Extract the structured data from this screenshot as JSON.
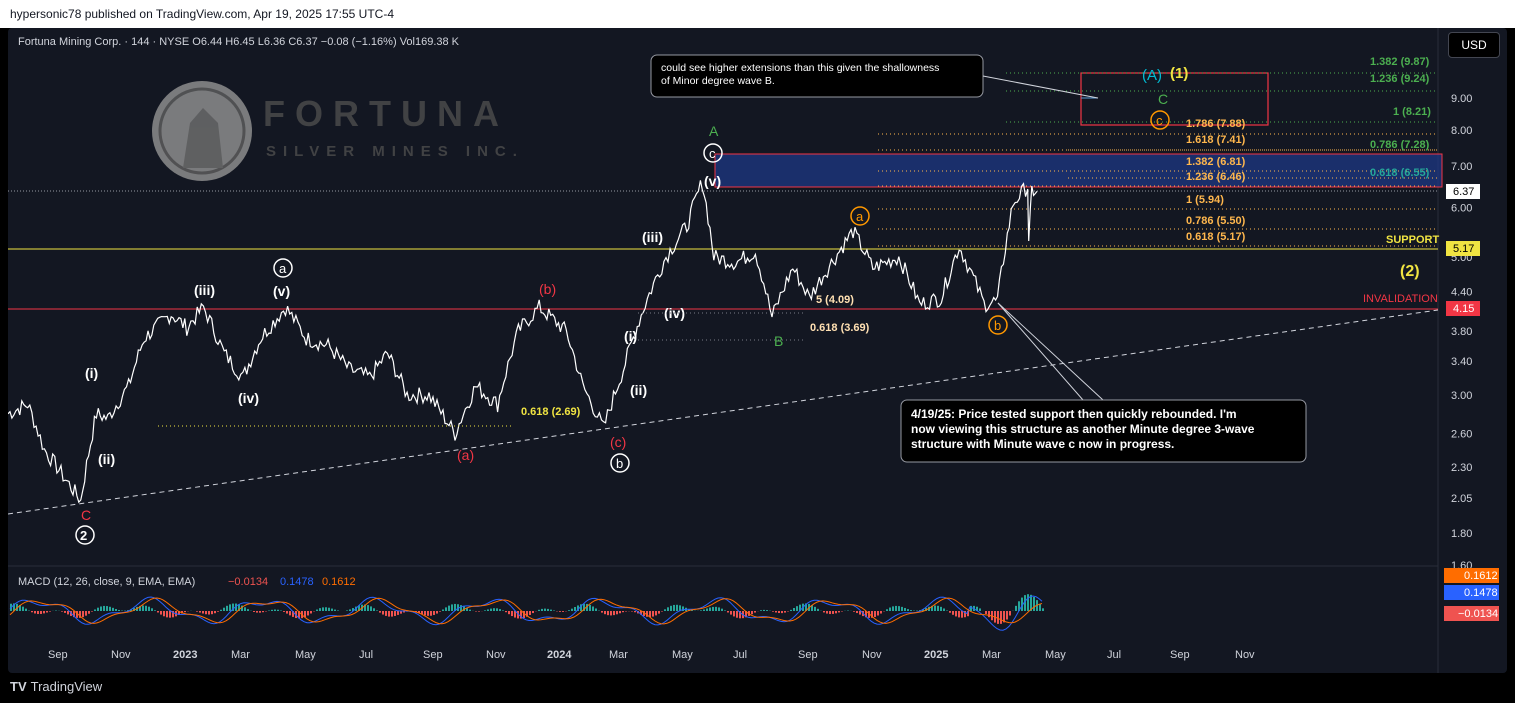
{
  "header": {
    "publish_line": "hypersonic78 published on TradingView.com, Apr 19, 2025 17:55 UTC-4"
  },
  "footer": {
    "brand": "TradingView",
    "logo": "TV"
  },
  "currency": "USD",
  "legend": {
    "symbol": "Fortuna Mining Corp. · 144 · NYSE",
    "o_label": "O",
    "o": "6.44",
    "h_label": "H",
    "h": "6.45",
    "l_label": "L",
    "l": "6.36",
    "c_label": "C",
    "c": "6.37",
    "chg": "−0.08 (−1.16%)",
    "vol_label": "Vol",
    "vol": "169.38 K"
  },
  "logo": {
    "name": "FORTUNA",
    "subtitle": "SILVER MINES INC."
  },
  "chart_data": {
    "type": "line",
    "price_axis": {
      "ticks": [
        "1.60",
        "1.80",
        "2.05",
        "2.30",
        "2.60",
        "3.00",
        "3.40",
        "3.80",
        "4.40",
        "5.00",
        "6.00",
        "7.00",
        "8.00",
        "9.00"
      ],
      "scale": "log"
    },
    "time_axis": [
      "Sep",
      "Nov",
      "2023",
      "Mar",
      "May",
      "Jul",
      "Sep",
      "Nov",
      "2024",
      "Mar",
      "May",
      "Jul",
      "Sep",
      "Nov",
      "2025",
      "Mar",
      "May",
      "Jul",
      "Sep",
      "Nov"
    ],
    "price_path": [
      [
        "2022-08-01",
        2.8
      ],
      [
        "2022-08-20",
        2.9
      ],
      [
        "2022-09-05",
        2.45
      ],
      [
        "2022-09-25",
        2.2
      ],
      [
        "2022-10-10",
        2.03
      ],
      [
        "2022-10-25",
        2.8
      ],
      [
        "2022-11-05",
        2.75
      ],
      [
        "2022-11-25",
        3.1
      ],
      [
        "2022-12-10",
        3.7
      ],
      [
        "2023-01-05",
        4.05
      ],
      [
        "2023-01-20",
        3.85
      ],
      [
        "2023-02-05",
        4.15
      ],
      [
        "2023-02-25",
        3.5
      ],
      [
        "2023-03-15",
        3.2
      ],
      [
        "2023-04-01",
        3.7
      ],
      [
        "2023-04-25",
        4.15
      ],
      [
        "2023-05-15",
        3.7
      ],
      [
        "2023-06-05",
        3.6
      ],
      [
        "2023-06-25",
        3.3
      ],
      [
        "2023-07-15",
        3.2
      ],
      [
        "2023-08-01",
        3.5
      ],
      [
        "2023-08-20",
        3.0
      ],
      [
        "2023-09-10",
        3.0
      ],
      [
        "2023-10-05",
        2.6
      ],
      [
        "2023-10-25",
        3.1
      ],
      [
        "2023-11-15",
        2.9
      ],
      [
        "2023-12-05",
        3.8
      ],
      [
        "2023-12-25",
        4.15
      ],
      [
        "2024-01-20",
        3.8
      ],
      [
        "2024-02-05",
        3.1
      ],
      [
        "2024-02-25",
        2.65
      ],
      [
        "2024-03-15",
        3.3
      ],
      [
        "2024-04-05",
        4.2
      ],
      [
        "2024-04-25",
        5.0
      ],
      [
        "2024-05-15",
        5.6
      ],
      [
        "2024-05-30",
        6.6
      ],
      [
        "2024-06-10",
        5.0
      ],
      [
        "2024-07-01",
        4.9
      ],
      [
        "2024-07-20",
        5.1
      ],
      [
        "2024-08-05",
        4.0
      ],
      [
        "2024-08-25",
        4.8
      ],
      [
        "2024-09-10",
        4.3
      ],
      [
        "2024-10-05",
        5.0
      ],
      [
        "2024-10-22",
        5.5
      ],
      [
        "2024-11-10",
        4.8
      ],
      [
        "2024-12-05",
        5.0
      ],
      [
        "2024-12-25",
        4.2
      ],
      [
        "2025-01-15",
        4.3
      ],
      [
        "2025-02-01",
        5.2
      ],
      [
        "2025-02-25",
        4.2
      ],
      [
        "2025-03-10",
        4.25
      ],
      [
        "2025-03-25",
        6.1
      ],
      [
        "2025-04-08",
        6.5
      ],
      [
        "2025-04-09",
        5.2
      ],
      [
        "2025-04-12",
        6.4
      ],
      [
        "2025-04-17",
        6.37
      ]
    ],
    "last_price": "6.37",
    "levels": [
      {
        "label": "SUPPORT",
        "value": "5.17",
        "color": "#f0e442"
      },
      {
        "label": "INVALIDATION",
        "value": "4.15",
        "color": "#f23645"
      }
    ],
    "fibonacci": [
      {
        "text": "1.382 (9.87)",
        "color": "#4caf50"
      },
      {
        "text": "1.236 (9.24)",
        "color": "#4caf50"
      },
      {
        "text": "1 (8.21)",
        "color": "#4caf50"
      },
      {
        "text": "0.786 (7.28)",
        "color": "#4caf50"
      },
      {
        "text": "0.618 (6.55)",
        "color": "#26a69a"
      },
      {
        "text": "1.786 (7.88)",
        "color": "#ffb74d"
      },
      {
        "text": "1.618 (7.41)",
        "color": "#ffb74d"
      },
      {
        "text": "1.382 (6.81)",
        "color": "#ffb74d"
      },
      {
        "text": "1.236 (6.46)",
        "color": "#ffb74d"
      },
      {
        "text": "1 (5.94)",
        "color": "#ffb74d"
      },
      {
        "text": "0.786 (5.50)",
        "color": "#ffb74d"
      },
      {
        "text": "0.618 (5.17)",
        "color": "#ffb74d"
      },
      {
        "text": "0.618 (2.69)",
        "color": "#f0e442"
      },
      {
        "text": "0.618 (3.69)",
        "color": "#ffe0b2"
      },
      {
        "text": "5 (4.09)",
        "color": "#ffe0b2"
      }
    ],
    "wave_labels": {
      "c_red": "C",
      "two_circle": "2",
      "i1": "(i)",
      "ii1": "(ii)",
      "iii1": "(iii)",
      "iv1": "(iv)",
      "v1": "(v)",
      "a_circle": "a",
      "a_paren_red": "(a)",
      "b_paren_red": "(b)",
      "c_paren_red": "(c)",
      "b_circle_white": "b",
      "i2": "(i)",
      "ii2": "(ii)",
      "iii2": "(iii)",
      "iv2": "(iv)",
      "v2": "(v)",
      "c_circle_white": "c",
      "A_green": "A",
      "B_green": "B",
      "a_orange": "a",
      "b_orange": "b",
      "c_orange": "c",
      "C_green": "C",
      "A_blue": "(A)",
      "one_yellow": "(1)",
      "two_yellow": "(2)"
    },
    "notes": [
      "could see higher extensions than this given the shallowness of Minor degree wave B.",
      "4/19/25: Price tested support then quickly rebounded.  I'm now viewing this structure as another Minute degree 3-wave structure with Minute wave c now in progress."
    ],
    "macd": {
      "label": "MACD (12, 26, close, 9, EMA, EMA)",
      "hist": "−0.0134",
      "macd": "0.1478",
      "signal": "0.1612",
      "colors": {
        "macd": "#2962ff",
        "signal": "#ff6d00",
        "hist_pos": "#26a69a",
        "hist_neg": "#ef5350"
      }
    },
    "colors": {
      "price": "#ffffff",
      "target_box": "#f23645",
      "zone_blue": "#1e3a8a"
    }
  }
}
